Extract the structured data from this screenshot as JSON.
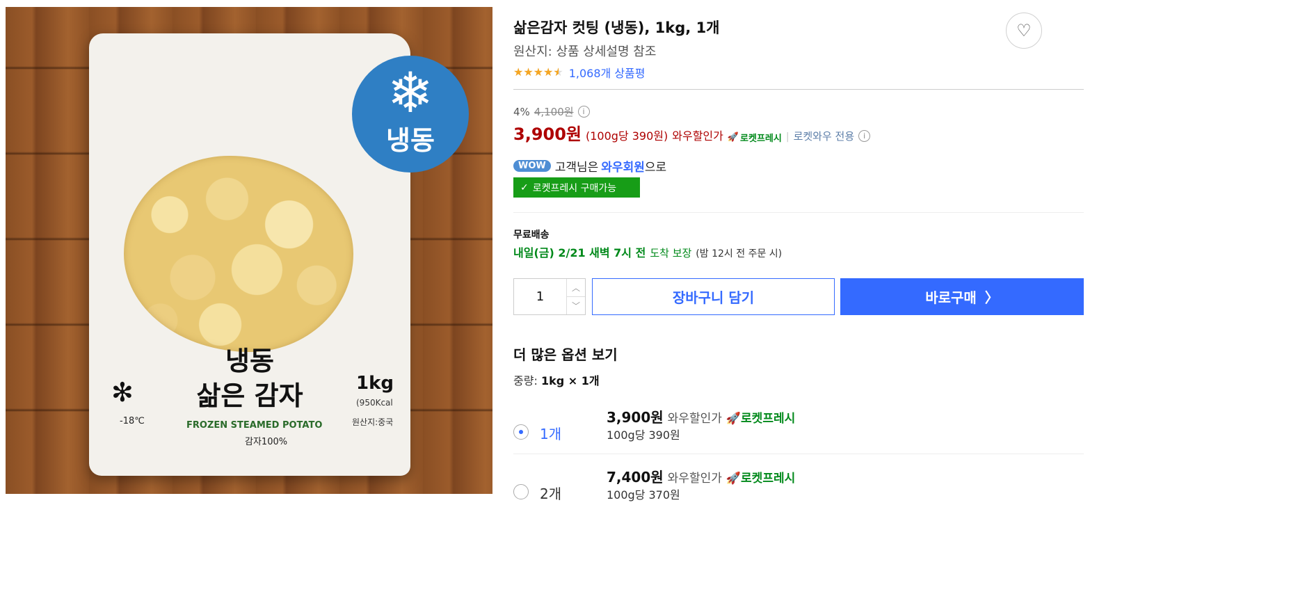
{
  "image": {
    "badge_text": "냉동",
    "bag_title_line1": "냉동",
    "bag_title_line2": "삶은 감자",
    "bag_en": "FROZEN STEAMED POTATO",
    "bag_percent": "감자100%",
    "bag_weight": "1kg",
    "bag_kcal": "(950Kcal",
    "bag_origin": "원산지:중국",
    "bag_temp": "-18℃"
  },
  "product": {
    "title": "삶은감자 컷팅 (냉동), 1kg, 1개",
    "origin": "원산지: 상품 상세설명 참조",
    "rating": 4.5,
    "review_count": "1,068개 상품평"
  },
  "pricing": {
    "discount_pct": "4%",
    "original_price": "4,100원",
    "price": "3,900원",
    "unit_price": "(100g당 390원)",
    "wow_label": "와우할인가",
    "rocket_label": "로켓프레시",
    "separator": "|",
    "wow_only": "로켓와우 전용"
  },
  "membership": {
    "badge": "WOW",
    "text_prefix": "고객님은",
    "member_name": "와우회원",
    "text_suffix": "으로",
    "fresh_available": "로켓프레시 구매가능"
  },
  "shipping": {
    "label": "무료배송",
    "date": "내일(금) 2/21 새벽 7시 전",
    "guarantee": "도착 보장",
    "note": "(밤 12시 전 주문 시)"
  },
  "actions": {
    "quantity": "1",
    "cart_button": "장바구니 담기",
    "buy_button": "바로구매"
  },
  "options": {
    "title": "더 많은 옵션 보기",
    "label_prefix": "중량:",
    "label_value": "1kg × 1개",
    "items": [
      {
        "name": "1개",
        "price": "3,900원",
        "wow": "와우할인가",
        "rocket": "로켓프레시",
        "unit": "100g당 390원",
        "selected": true
      },
      {
        "name": "2개",
        "price": "7,400원",
        "wow": "와우할인가",
        "rocket": "로켓프레시",
        "unit": "100g당 370원",
        "selected": false
      }
    ]
  }
}
